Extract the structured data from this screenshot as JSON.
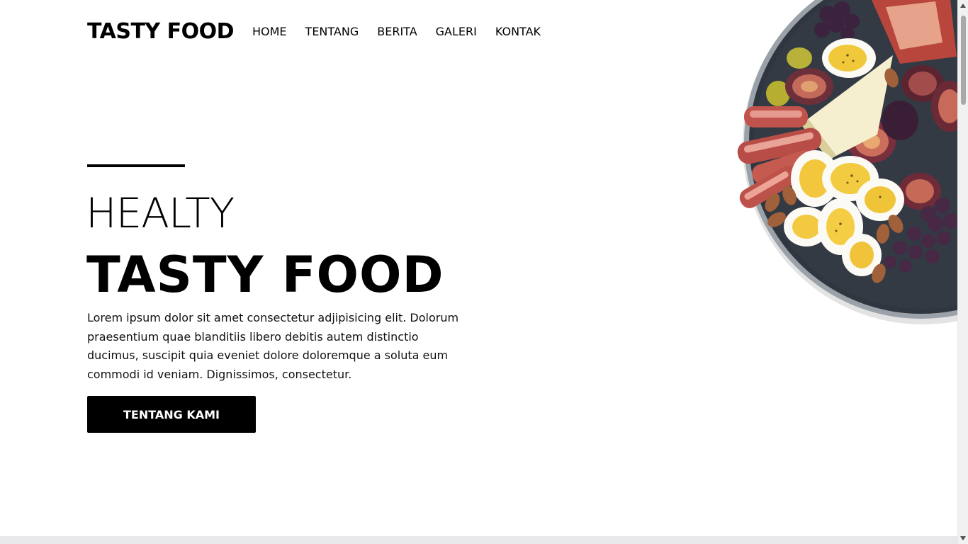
{
  "header": {
    "brand": "TASTY FOOD",
    "nav": [
      {
        "label": "HOME"
      },
      {
        "label": "TENTANG"
      },
      {
        "label": "BERITA"
      },
      {
        "label": "GALERI"
      },
      {
        "label": "KONTAK"
      }
    ]
  },
  "hero": {
    "subtitle": "HEALTY",
    "title": "TASTY FOOD",
    "description": "Lorem ipsum dolor sit amet consectetur adjipisicing elit. Dolorum praesentium quae blanditiis libero debitis autem distinctio ducimus, suscipit quia eveniet dolore doloremque a soluta eum commodi id veniam. Dignissimos, consectetur.",
    "cta_label": "TENTANG KAMI"
  },
  "colors": {
    "text": "#000000",
    "background": "#ffffff",
    "button_bg": "#000000",
    "button_text": "#ffffff",
    "plate": "#2f3640"
  },
  "icons": {
    "plate_image": "food-plate-image",
    "scroll_up": "scroll-up-arrow-icon",
    "scroll_down": "scroll-down-arrow-icon"
  }
}
